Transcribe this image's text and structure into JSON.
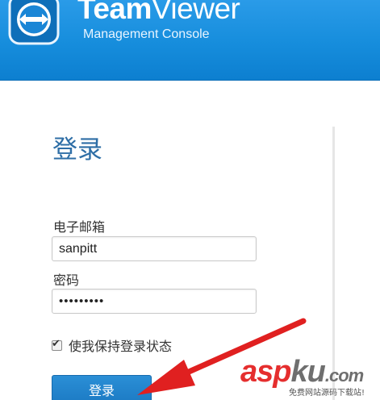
{
  "header": {
    "brand_bold": "Team",
    "brand_regular": "Viewer",
    "subtitle": "Management Console"
  },
  "login": {
    "title": "登录",
    "email_label": "电子邮箱",
    "email_value": "sanpitt",
    "password_label": "密码",
    "password_value": "•••••••••",
    "remember_label": "使我保持登录状态",
    "remember_checked": true,
    "submit_label": "登录"
  },
  "watermark": {
    "part1": "asp",
    "part2": "ku",
    "part3": ".com",
    "subtitle": "免费网站源码下载站!"
  },
  "colors": {
    "header_blue": "#168ddc",
    "title_blue": "#2e6ea6",
    "button_blue": "#1a78c2",
    "arrow_red": "#e02020"
  }
}
